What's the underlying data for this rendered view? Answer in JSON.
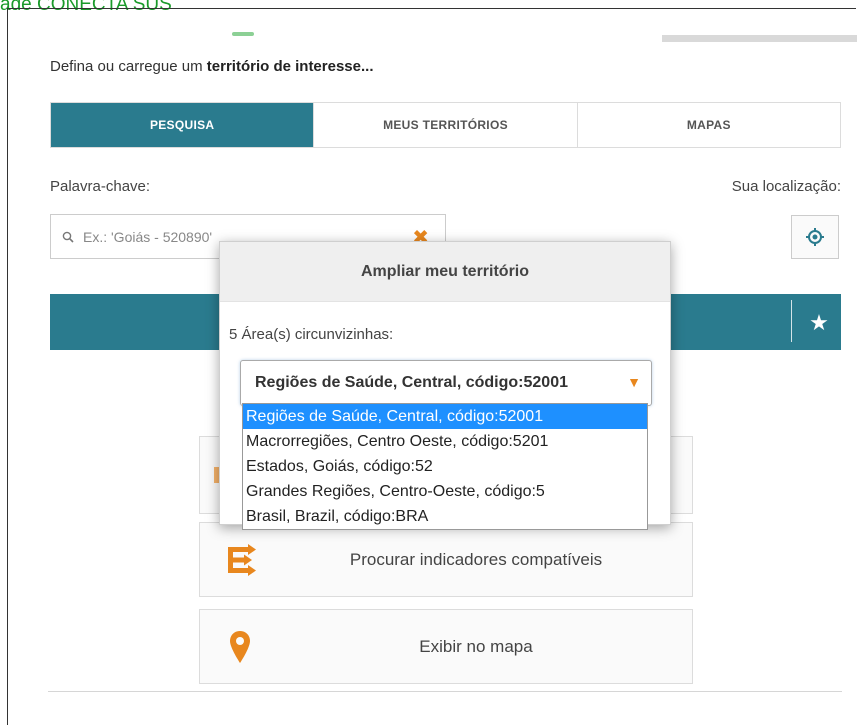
{
  "caption": "ade CONECTA SUS",
  "intro": {
    "text": "Defina ou carregue um ",
    "bold": "território de interesse..."
  },
  "tabs": [
    {
      "label": "PESQUISA",
      "active": true
    },
    {
      "label": "MEUS TERRITÓRIOS",
      "active": false
    },
    {
      "label": "MAPAS",
      "active": false
    }
  ],
  "search": {
    "keyword_label": "Palavra-chave:",
    "placeholder": "Ex.: 'Goiás - 520890'",
    "location_label": "Sua localização:"
  },
  "modal": {
    "title": "Ampliar meu território",
    "subtitle": "5 Área(s) circunvizinhas:",
    "selected": "Regiões de Saúde, Central, código:52001",
    "options": [
      {
        "label": "Regiões de Saúde, Central, código:52001",
        "selected": true
      },
      {
        "label": "Macrorregiões, Centro Oeste, código:5201",
        "selected": false
      },
      {
        "label": "Estados, Goiás, código:52",
        "selected": false
      },
      {
        "label": "Grandes Regiões, Centro-Oeste, código:5",
        "selected": false
      },
      {
        "label": "Brasil, Brazil, código:BRA",
        "selected": false
      }
    ]
  },
  "actions": [
    {
      "label": "Procurar indicadores compatíveis",
      "icon": "flow-arrows-icon"
    },
    {
      "label": "Exibir no mapa",
      "icon": "map-pin-icon"
    }
  ],
  "colors": {
    "primary": "#2a7b8e",
    "accent": "#e8871e",
    "highlight": "#1e90ff",
    "caption": "#1a9a2a"
  }
}
